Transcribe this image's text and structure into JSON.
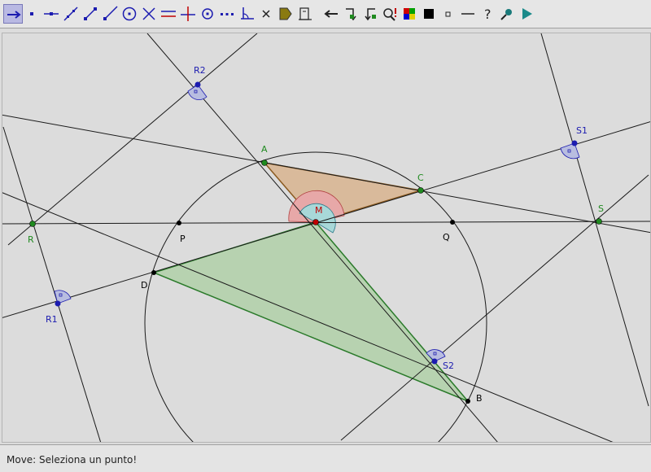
{
  "colors": {
    "line": "#1a1a1a",
    "green_point": "#1f8a1f",
    "blue_point": "#1c1cb0",
    "red_point": "#c00000",
    "black_point": "#000000",
    "triangle_orange_fill": "#d8b48f",
    "triangle_orange_stroke": "#8a5a20",
    "triangle_green_fill": "#b0d0a8",
    "triangle_green_stroke": "#2a7a2a",
    "right_angle_fill": "#b8bde0",
    "angle_red_fill": "#e7a8a8",
    "angle_cyan_fill": "#a8d8d8",
    "selected_tool": "#b9b9e3"
  },
  "toolbar": {
    "tools": [
      {
        "name": "move-tool",
        "icon": "move-arrow-icon",
        "selected": true
      },
      {
        "name": "point-tool",
        "icon": "point-icon"
      },
      {
        "name": "point-on-line-tool",
        "icon": "point-on-line-icon"
      },
      {
        "name": "line-tool",
        "icon": "line-through-points-icon"
      },
      {
        "name": "segment-tool",
        "icon": "segment-icon"
      },
      {
        "name": "ray-tool",
        "icon": "ray-icon"
      },
      {
        "name": "circle-tool",
        "icon": "circle-icon"
      },
      {
        "name": "intersect-tool",
        "icon": "intersect-icon"
      },
      {
        "name": "parallel-tool",
        "icon": "parallel-line-icon"
      },
      {
        "name": "perpendicular-tool",
        "icon": "perpendicular-line-icon"
      },
      {
        "name": "midpoint-tool",
        "icon": "midpoint-icon"
      },
      {
        "name": "polyline-tool",
        "icon": "polyline-icon"
      },
      {
        "name": "angle-tool",
        "icon": "angle-icon"
      },
      {
        "name": "delete-tool",
        "icon": "delete-x-icon"
      },
      {
        "name": "label-tool",
        "icon": "label-tag-icon"
      },
      {
        "name": "measure-tool",
        "icon": "measure-icon"
      },
      {
        "name": "undo-tool",
        "icon": "undo-arrow-icon"
      },
      {
        "name": "redo-tool",
        "icon": "redo-arrow-icon"
      },
      {
        "name": "history-tool",
        "icon": "history-icon"
      },
      {
        "name": "search-tool",
        "icon": "search-magnifier-icon"
      },
      {
        "name": "color-tool",
        "icon": "color-palette-icon"
      },
      {
        "name": "fill-tool",
        "icon": "fill-square-icon"
      },
      {
        "name": "small-point-tool",
        "icon": "small-point-icon"
      },
      {
        "name": "line-style-tool",
        "icon": "line-style-icon"
      },
      {
        "name": "help-tool",
        "icon": "question-mark-icon"
      },
      {
        "name": "zoom-tool",
        "icon": "zoom-icon"
      },
      {
        "name": "play-tool",
        "icon": "play-triangle-icon"
      }
    ]
  },
  "labels": {
    "A": "A",
    "B": "B",
    "C": "C",
    "D": "D",
    "M": "M",
    "P": "P",
    "Q": "Q",
    "R": "R",
    "S": "S",
    "R1": "R1",
    "R2": "R2",
    "S1": "S1",
    "S2": "S2"
  },
  "status": {
    "message": "Move: Seleziona un punto!"
  }
}
